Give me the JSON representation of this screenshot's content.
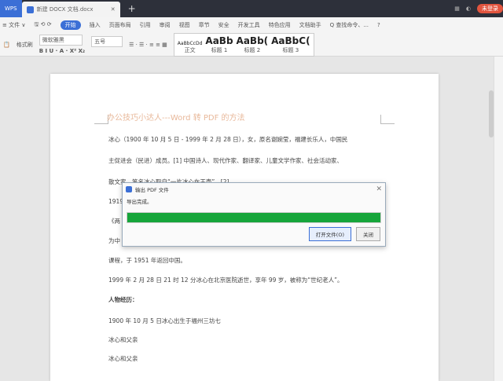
{
  "tabbar": {
    "app": "WPS",
    "doc_tab": "新建 DOCX 文档.docx",
    "login": "未登录"
  },
  "menu": {
    "items": [
      "≡ 文件 ∨",
      "开始",
      "插入",
      "页面布局",
      "引用",
      "审阅",
      "视图",
      "章节",
      "安全",
      "开发工具",
      "特色应用",
      "文档助手",
      "Q 查找命令、..."
    ],
    "active": "开始",
    "help": "?"
  },
  "ribbon": {
    "font": "微软雅黑",
    "size": "五号",
    "format_painter": "格式刷",
    "styles": [
      "AaBbCcDd",
      "AaBb",
      "AaBb(",
      "AaBbC("
    ],
    "style_names": [
      "正文",
      "标题 1",
      "标题 2",
      "标题 3"
    ]
  },
  "document": {
    "title": "办公技巧小达人---Word 转 PDF 的方法",
    "lines": [
      "冰心（1900 年 10 月 5 日 - 1999 年 2 月 28 日），女，原名谢婉莹，福建长乐人，中国民",
      "主促进会（民进）成员。[1] 中国诗人、现代作家、翻译家、儿童文学作家、社会活动家、",
      "散文家。笔名冰心取自“一片冰心在玉壶”。[2]",
      "1919",
      "《两",
      "为中",
      "课程，于 1951 年返回中国。",
      "1999 年 2 月 28 日 21 时 12 分冰心在北京医院逝世，享年 99 岁，被称为“世纪老人”。",
      "人物经历：",
      "1900 年 10 月 5 日冰心出生于福州三坊七",
      "冰心和父亲",
      "冰心和父亲"
    ]
  },
  "dialog": {
    "title": "输出 PDF 文件",
    "message": "导出完成。",
    "progress_percent": 100,
    "progress_color": "#16a53a",
    "open_button": "打开文件(O)",
    "close_button": "关闭"
  }
}
